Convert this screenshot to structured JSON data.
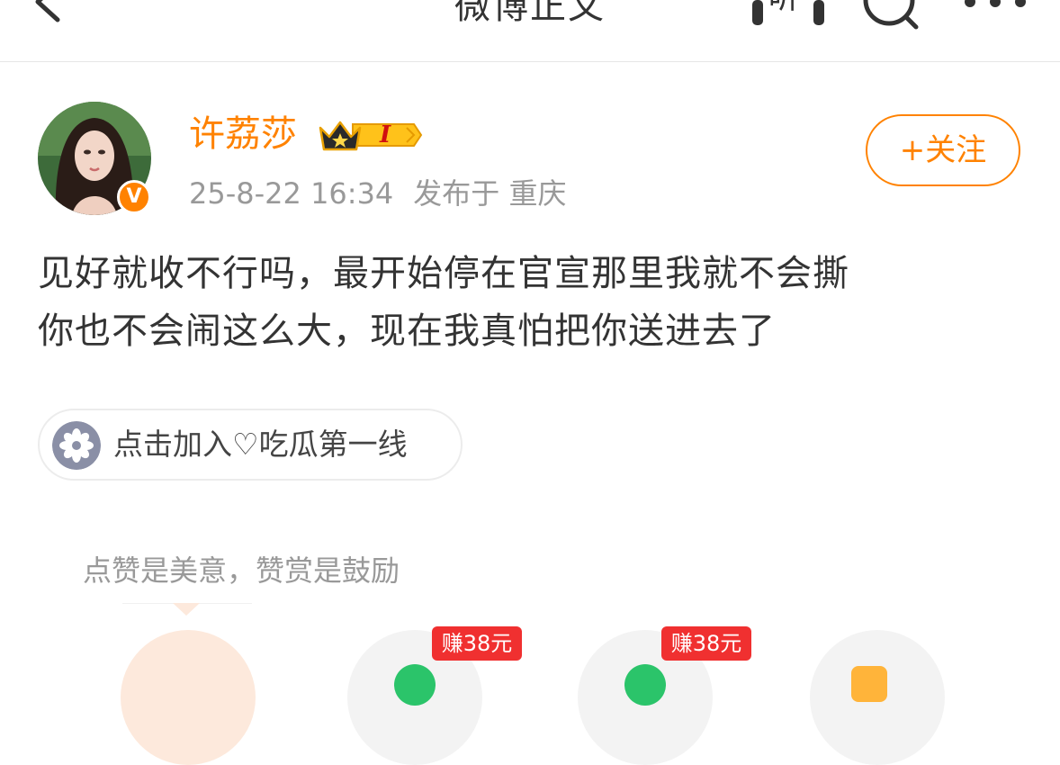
{
  "nav": {
    "title": "微博正文",
    "listen_label": "听",
    "icons": [
      "back-icon",
      "headphones-icon",
      "search-icon",
      "more-icon"
    ]
  },
  "post": {
    "author": "许荔莎",
    "verified_mark": "V",
    "level_mark": "I",
    "time": "25-8-22 16:34",
    "location": "发布于 重庆",
    "follow_label": "+关注",
    "text_line1": "见好就收不行吗，最开始停在官宣那里我就不会撕",
    "text_line2": "你也不会闹这么大，现在我真怕把你送进去了"
  },
  "topic": {
    "label": "点击加入♡吃瓜第一线",
    "icon": "flower-icon"
  },
  "reward": {
    "hint": "点赞是美意，赞赏是鼓励",
    "badges": [
      "赚38元",
      "赚38元"
    ]
  },
  "colors": {
    "accent": "#ff8200",
    "badge_red": "#f03030",
    "green": "#2bc46a"
  }
}
